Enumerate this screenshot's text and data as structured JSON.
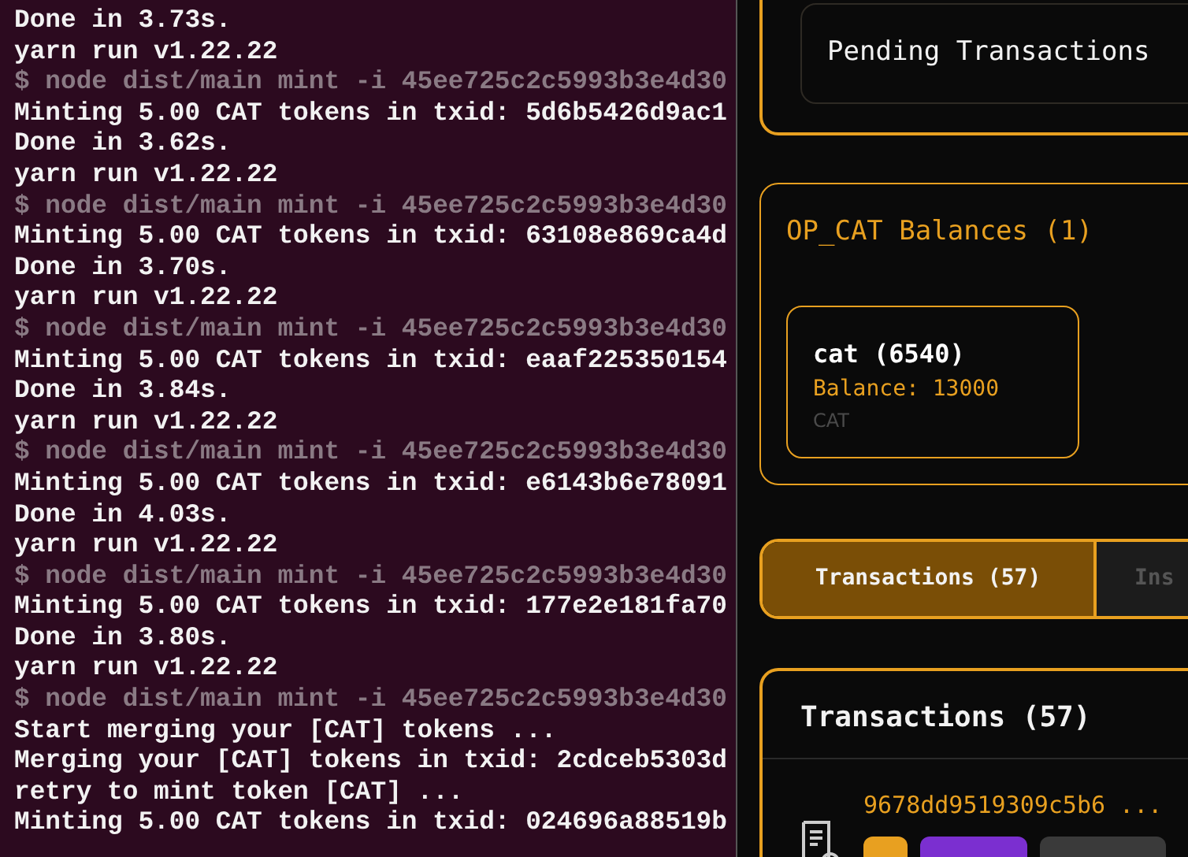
{
  "terminal": {
    "lines": [
      {
        "kind": "output",
        "text": "Done in 3.73s."
      },
      {
        "kind": "output",
        "text": "yarn run v1.22.22"
      },
      {
        "kind": "command",
        "text": "$ node dist/main mint -i 45ee725c2c5993b3e4d30"
      },
      {
        "kind": "output",
        "text": "Minting 5.00 CAT tokens in txid: 5d6b5426d9ac1"
      },
      {
        "kind": "output",
        "text": "Done in 3.62s."
      },
      {
        "kind": "output",
        "text": "yarn run v1.22.22"
      },
      {
        "kind": "command",
        "text": "$ node dist/main mint -i 45ee725c2c5993b3e4d30"
      },
      {
        "kind": "output",
        "text": "Minting 5.00 CAT tokens in txid: 63108e869ca4d"
      },
      {
        "kind": "output",
        "text": "Done in 3.70s."
      },
      {
        "kind": "output",
        "text": "yarn run v1.22.22"
      },
      {
        "kind": "command",
        "text": "$ node dist/main mint -i 45ee725c2c5993b3e4d30"
      },
      {
        "kind": "output",
        "text": "Minting 5.00 CAT tokens in txid: eaaf225350154"
      },
      {
        "kind": "output",
        "text": "Done in 3.84s."
      },
      {
        "kind": "output",
        "text": "yarn run v1.22.22"
      },
      {
        "kind": "command",
        "text": "$ node dist/main mint -i 45ee725c2c5993b3e4d30"
      },
      {
        "kind": "output",
        "text": "Minting 5.00 CAT tokens in txid: e6143b6e78091"
      },
      {
        "kind": "output",
        "text": "Done in 4.03s."
      },
      {
        "kind": "output",
        "text": "yarn run v1.22.22"
      },
      {
        "kind": "command",
        "text": "$ node dist/main mint -i 45ee725c2c5993b3e4d30"
      },
      {
        "kind": "output",
        "text": "Minting 5.00 CAT tokens in txid: 177e2e181fa70"
      },
      {
        "kind": "output",
        "text": "Done in 3.80s."
      },
      {
        "kind": "output",
        "text": "yarn run v1.22.22"
      },
      {
        "kind": "command",
        "text": "$ node dist/main mint -i 45ee725c2c5993b3e4d30"
      },
      {
        "kind": "output",
        "text": "Start merging your [CAT] tokens ..."
      },
      {
        "kind": "output",
        "text": "Merging your [CAT] tokens in txid: 2cdceb5303d"
      },
      {
        "kind": "output",
        "text": "retry to mint token [CAT] ..."
      },
      {
        "kind": "output",
        "text": "Minting 5.00 CAT tokens in txid: 024696a88519b"
      }
    ]
  },
  "pending": {
    "label": "Pending Transactions"
  },
  "balances": {
    "title": "OP_CAT Balances (1)",
    "tokens": [
      {
        "name": "cat (6540)",
        "balance": "Balance: 13000",
        "symbol": "CAT"
      }
    ]
  },
  "tabs": [
    {
      "label": "Transactions (57)",
      "selected": true
    },
    {
      "label": "Ins",
      "selected": false
    }
  ],
  "transactions": {
    "title": "Transactions (57)",
    "rows": [
      {
        "txid": "9678dd9519309c5b6 ...",
        "badges": [
          {
            "color": "#e8a020"
          },
          {
            "color": "#7b2fd0"
          },
          {
            "color": "#3a3a3a"
          }
        ]
      }
    ]
  }
}
